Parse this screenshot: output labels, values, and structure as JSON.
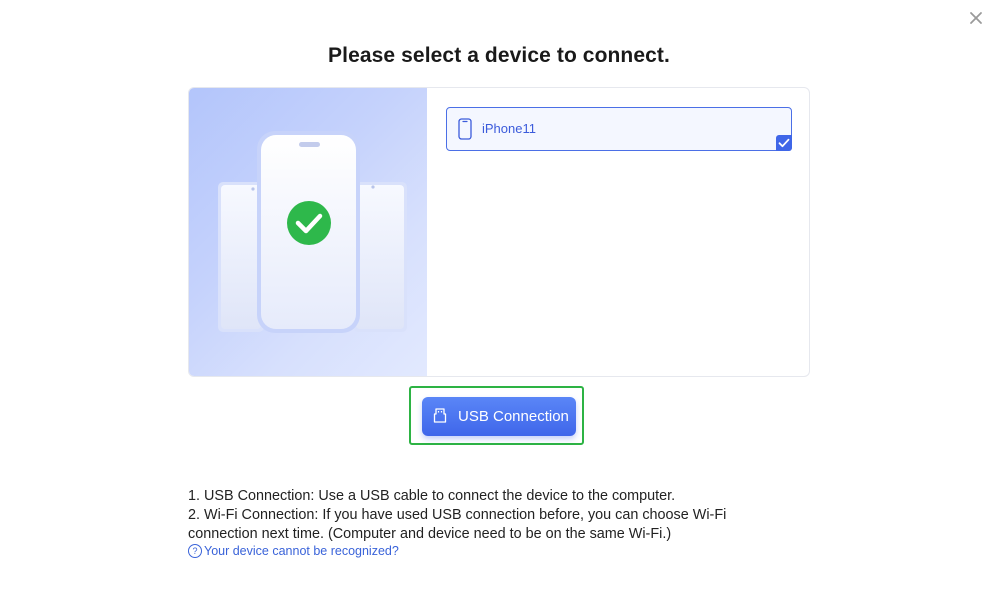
{
  "dialog": {
    "title": "Please select a device to connect.",
    "close_icon": "close-icon"
  },
  "devices": [
    {
      "name": "iPhone11",
      "icon": "phone-icon",
      "selected": true
    }
  ],
  "actions": {
    "usb_button_label": "USB Connection",
    "usb_icon": "usb-plug-icon"
  },
  "instructions": {
    "line1": "1. USB Connection: Use a USB cable to connect the device to the computer.",
    "line2": "2. Wi-Fi Connection: If you have used USB connection before, you can choose Wi-Fi connection next time. (Computer and device need to be on the same Wi-Fi.)"
  },
  "help": {
    "icon": "question-circle-icon",
    "icon_glyph": "?",
    "link_text": "Your device cannot be recognized?"
  },
  "colors": {
    "accent": "#3f66ea",
    "highlight_border": "#2db344",
    "success_check": "#2eb84b",
    "link": "#3a63d9"
  }
}
